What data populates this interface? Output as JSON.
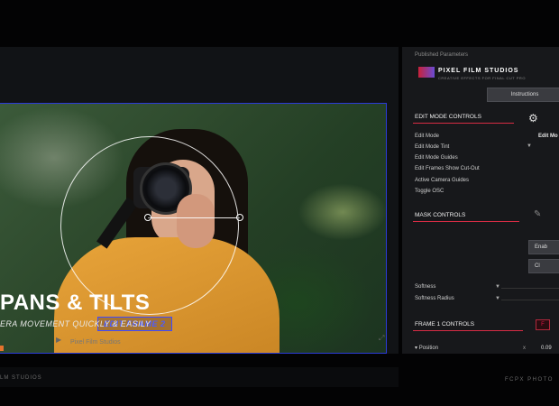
{
  "viewer": {
    "frame_label": "EDIT FRAME 2",
    "timeline_label": "Pixel Film Studios"
  },
  "overlay": {
    "title": "PANS & TILTS",
    "subtitle": "ERA MOVEMENT QUICKLY & EASILY"
  },
  "inspector": {
    "header": "Published Parameters",
    "logo_text": "PIXEL FILM STUDIOS",
    "logo_tagline": "CREATIVE EFFECTS FOR FINAL CUT PRO",
    "instructions_button": "Instructions",
    "edit_mode_section": "EDIT MODE CONTROLS",
    "edit_mode_rows": [
      "Edit Mode",
      "Edit Mode Tint",
      "Edit Mode Guides",
      "Edit Frames Show Cut-Out",
      "Active Camera Guides",
      "Toggle OSC"
    ],
    "edit_mode_value": "Edit Mo",
    "mask_section": "MASK CONTROLS",
    "enable_button": "Enab",
    "clear_button": "Cl",
    "softness": "Softness",
    "softness_radius": "Softness Radius",
    "frame_section": "FRAME 1 CONTROLS",
    "position": "Position",
    "position_value": "0.09",
    "frame_pill": "F"
  },
  "footer": {
    "left": "LM STUDIOS",
    "right": "FCPX PHOTO"
  },
  "colors": {
    "accent_red": "#d72c44",
    "frame_blue": "#2b3bd8",
    "sweater": "#e8a43a"
  }
}
